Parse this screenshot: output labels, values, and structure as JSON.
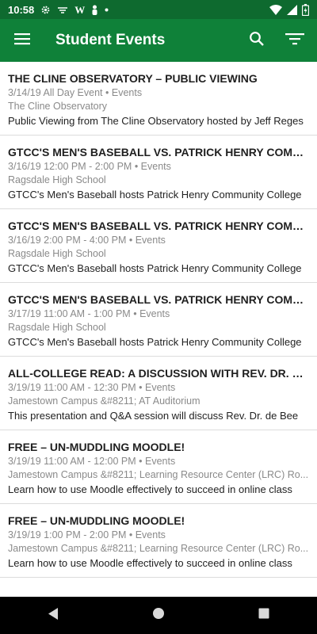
{
  "status_bar": {
    "time": "10:58",
    "icons": [
      "gear-icon",
      "hidden-network-icon",
      "w-icon",
      "person-icon",
      "dot-icon",
      "wifi-icon",
      "signal-icon",
      "battery-icon"
    ]
  },
  "app_bar": {
    "title": "Student Events",
    "accent_color": "#0f8139",
    "status_color": "#0e6a2f"
  },
  "events": [
    {
      "title": "THE CLINE OBSERVATORY – PUBLIC VIEWING",
      "datetime": "3/14/19 All Day Event",
      "category": "Events",
      "location": "The Cline Observatory",
      "description": "Public Viewing from The Cline Observatory hosted by Jeff Reges"
    },
    {
      "title": "GTCC'S MEN'S BASEBALL VS. PATRICK HENRY COMMUNITY COLLEGE",
      "datetime": "3/16/19 12:00 PM - 2:00 PM",
      "category": "Events",
      "location": "Ragsdale High School",
      "description": "GTCC's Men's Baseball hosts Patrick Henry Community College"
    },
    {
      "title": "GTCC'S MEN'S BASEBALL VS. PATRICK HENRY COMMUNITY COLLEGE",
      "datetime": "3/16/19 2:00 PM - 4:00 PM",
      "category": "Events",
      "location": "Ragsdale High School",
      "description": "GTCC's Men's Baseball hosts Patrick Henry Community College"
    },
    {
      "title": "GTCC'S MEN'S BASEBALL VS. PATRICK HENRY COMMUNITY COLLEGE",
      "datetime": "3/17/19 11:00 AM - 1:00 PM",
      "category": "Events",
      "location": "Ragsdale High School",
      "description": "GTCC's Men's Baseball hosts Patrick Henry Community College"
    },
    {
      "title": "ALL-COLLEGE READ: A DISCUSSION WITH REV. DR. JO...",
      "datetime": "3/19/19 11:00 AM - 12:30 PM",
      "category": "Events",
      "location": "Jamestown Campus &#8211; AT Auditorium",
      "description": "This presentation and Q&A session will discuss Rev. Dr. de Bee"
    },
    {
      "title": "FREE – UN-MUDDLING MOODLE!",
      "datetime": "3/19/19 11:00 AM - 12:00 PM",
      "category": "Events",
      "location": "Jamestown Campus &#8211; Learning Resource Center (LRC) Ro...",
      "description": "Learn how to use Moodle effectively to succeed in online class"
    },
    {
      "title": "FREE – UN-MUDDLING MOODLE!",
      "datetime": "3/19/19 1:00 PM - 2:00 PM",
      "category": "Events",
      "location": "Jamestown Campus &#8211; Learning Resource Center (LRC) Ro...",
      "description": "Learn how to use Moodle effectively to succeed in online class"
    }
  ],
  "nav_bar": {
    "icons": [
      "back-icon",
      "home-icon",
      "recents-icon"
    ]
  }
}
